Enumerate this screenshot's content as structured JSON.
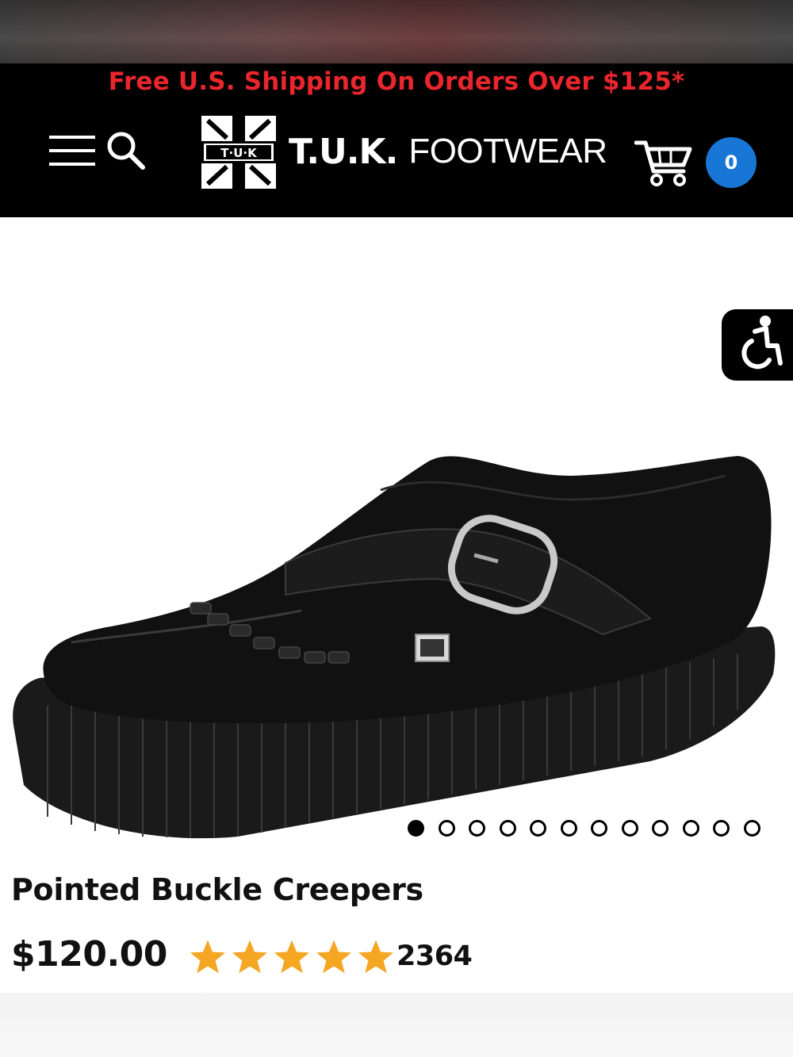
{
  "promo": {
    "text": "Free U.S. Shipping On Orders Over $125*"
  },
  "header": {
    "brand_bold": "T.U.K.",
    "brand_light": "FOOTWEAR",
    "logo_mark_text": "T·U·K",
    "cart_count": "0",
    "icons": [
      "hamburger-menu-icon",
      "search-icon",
      "cart-icon",
      "accessibility-icon"
    ]
  },
  "gallery": {
    "image_alt": "Pointed Buckle Creepers product photo",
    "total_images": 12,
    "active_index": 0
  },
  "product": {
    "title": "Pointed Buckle Creepers",
    "price": "$120.00",
    "rating": 5,
    "rating_max": 5,
    "review_count": "2364"
  },
  "colors": {
    "promo": "#e8262c",
    "badge": "#1877d6",
    "star": "#f5a623",
    "header_bg": "#000000"
  }
}
